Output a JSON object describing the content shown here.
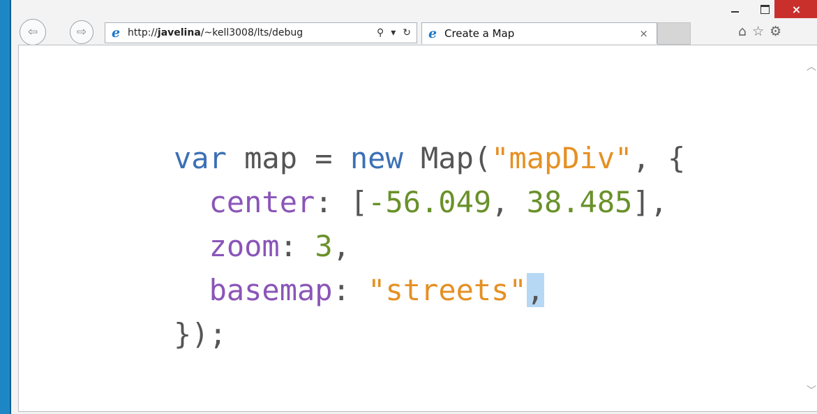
{
  "browser": {
    "url": "http://javelina/~kell3008/lts/debug",
    "url_host": "javelina",
    "url_prefix": "http://",
    "url_rest": "/~kell3008/lts/debug",
    "tab_title": "Create a Map",
    "tab_close": "×",
    "search_icon": "⚲",
    "dropdown": "▾",
    "refresh": "↻",
    "icons": [
      "home-icon",
      "favorites-icon",
      "settings-icon"
    ]
  },
  "window_controls": {
    "close": "×"
  },
  "code": {
    "line1": {
      "kw_var": "var",
      "name": " map ",
      "eq": "= ",
      "kw_new": "new",
      "ctor": " Map(",
      "arg": "\"mapDiv\"",
      "rest": ", {"
    },
    "line2": {
      "indent": "  ",
      "prop": "center",
      "colon": ": [",
      "n1": "-56.049",
      "comma": ", ",
      "n2": "38.485",
      "end": "],"
    },
    "line3": {
      "indent": "  ",
      "prop": "zoom",
      "colon": ": ",
      "n": "3",
      "end": ","
    },
    "line4": {
      "indent": "  ",
      "prop": "basemap",
      "colon": ": ",
      "str": "\"streets\"",
      "sel": ","
    },
    "line5": {
      "text": "});"
    }
  },
  "colors": {
    "keyword": "#3c70b5",
    "property": "#8a55b8",
    "number": "#69912a",
    "string": "#e59024",
    "selection": "#b7d8f4",
    "desktop": "#1d87c6"
  }
}
